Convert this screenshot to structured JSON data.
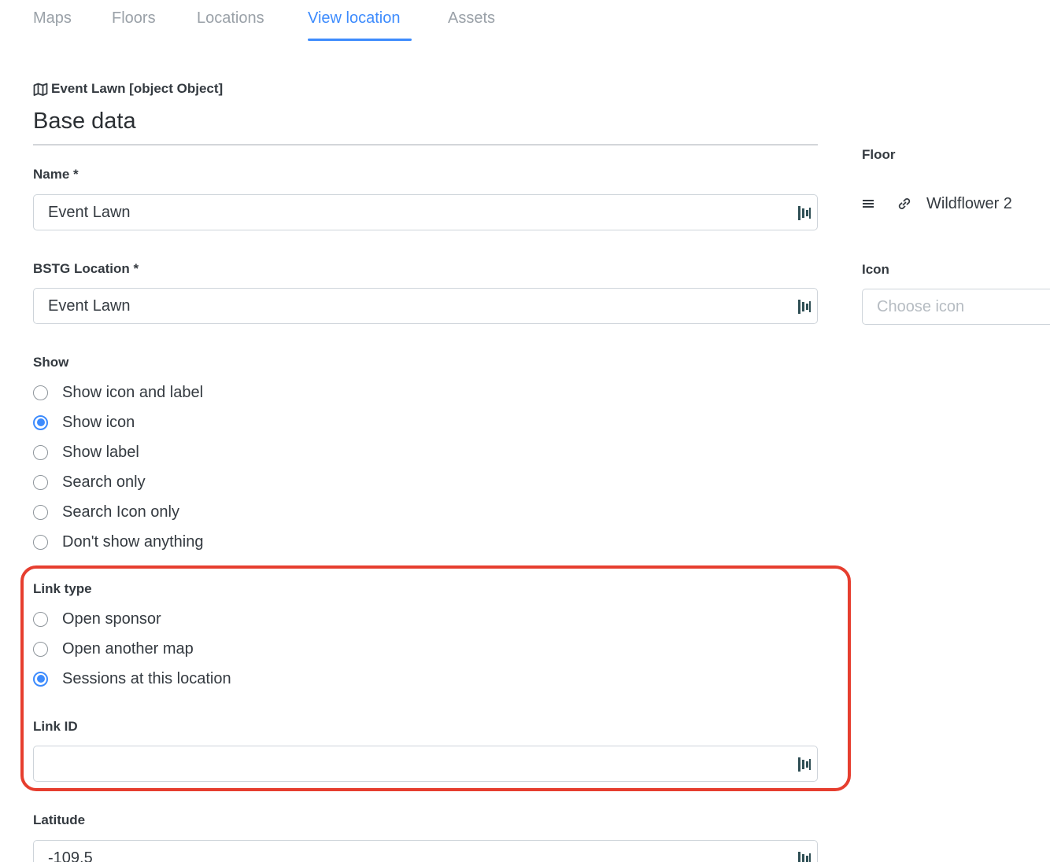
{
  "tabs": [
    {
      "label": "Maps",
      "active": false
    },
    {
      "label": "Floors",
      "active": false
    },
    {
      "label": "Locations",
      "active": false
    },
    {
      "label": "View location",
      "active": true
    },
    {
      "label": "Assets",
      "active": false
    }
  ],
  "breadcrumb": {
    "text": "Event Lawn [object Object]",
    "icon": "map-icon"
  },
  "section_title": "Base data",
  "form": {
    "name": {
      "label": "Name *",
      "value": "Event Lawn"
    },
    "bstg_location": {
      "label": "BSTG Location *",
      "value": "Event Lawn"
    },
    "show": {
      "label": "Show",
      "options": [
        "Show icon and label",
        "Show icon",
        "Show label",
        "Search only",
        "Search Icon only",
        "Don't show anything"
      ],
      "selected": "Show icon"
    },
    "link_type": {
      "label": "Link type",
      "options": [
        "Open sponsor",
        "Open another map",
        "Sessions at this location"
      ],
      "selected": "Sessions at this location"
    },
    "link_id": {
      "label": "Link ID",
      "value": ""
    },
    "latitude": {
      "label": "Latitude",
      "value": "-109.5"
    }
  },
  "side": {
    "floor": {
      "label": "Floor",
      "value": "Wildflower 2",
      "icons": [
        "menu-icon",
        "link-icon"
      ]
    },
    "icon": {
      "label": "Icon",
      "placeholder": "Choose icon"
    }
  },
  "colors": {
    "accent": "#3d8bfd",
    "highlight": "#e63e2f",
    "muted_text": "#9aa1a8",
    "border": "#ced4da"
  }
}
